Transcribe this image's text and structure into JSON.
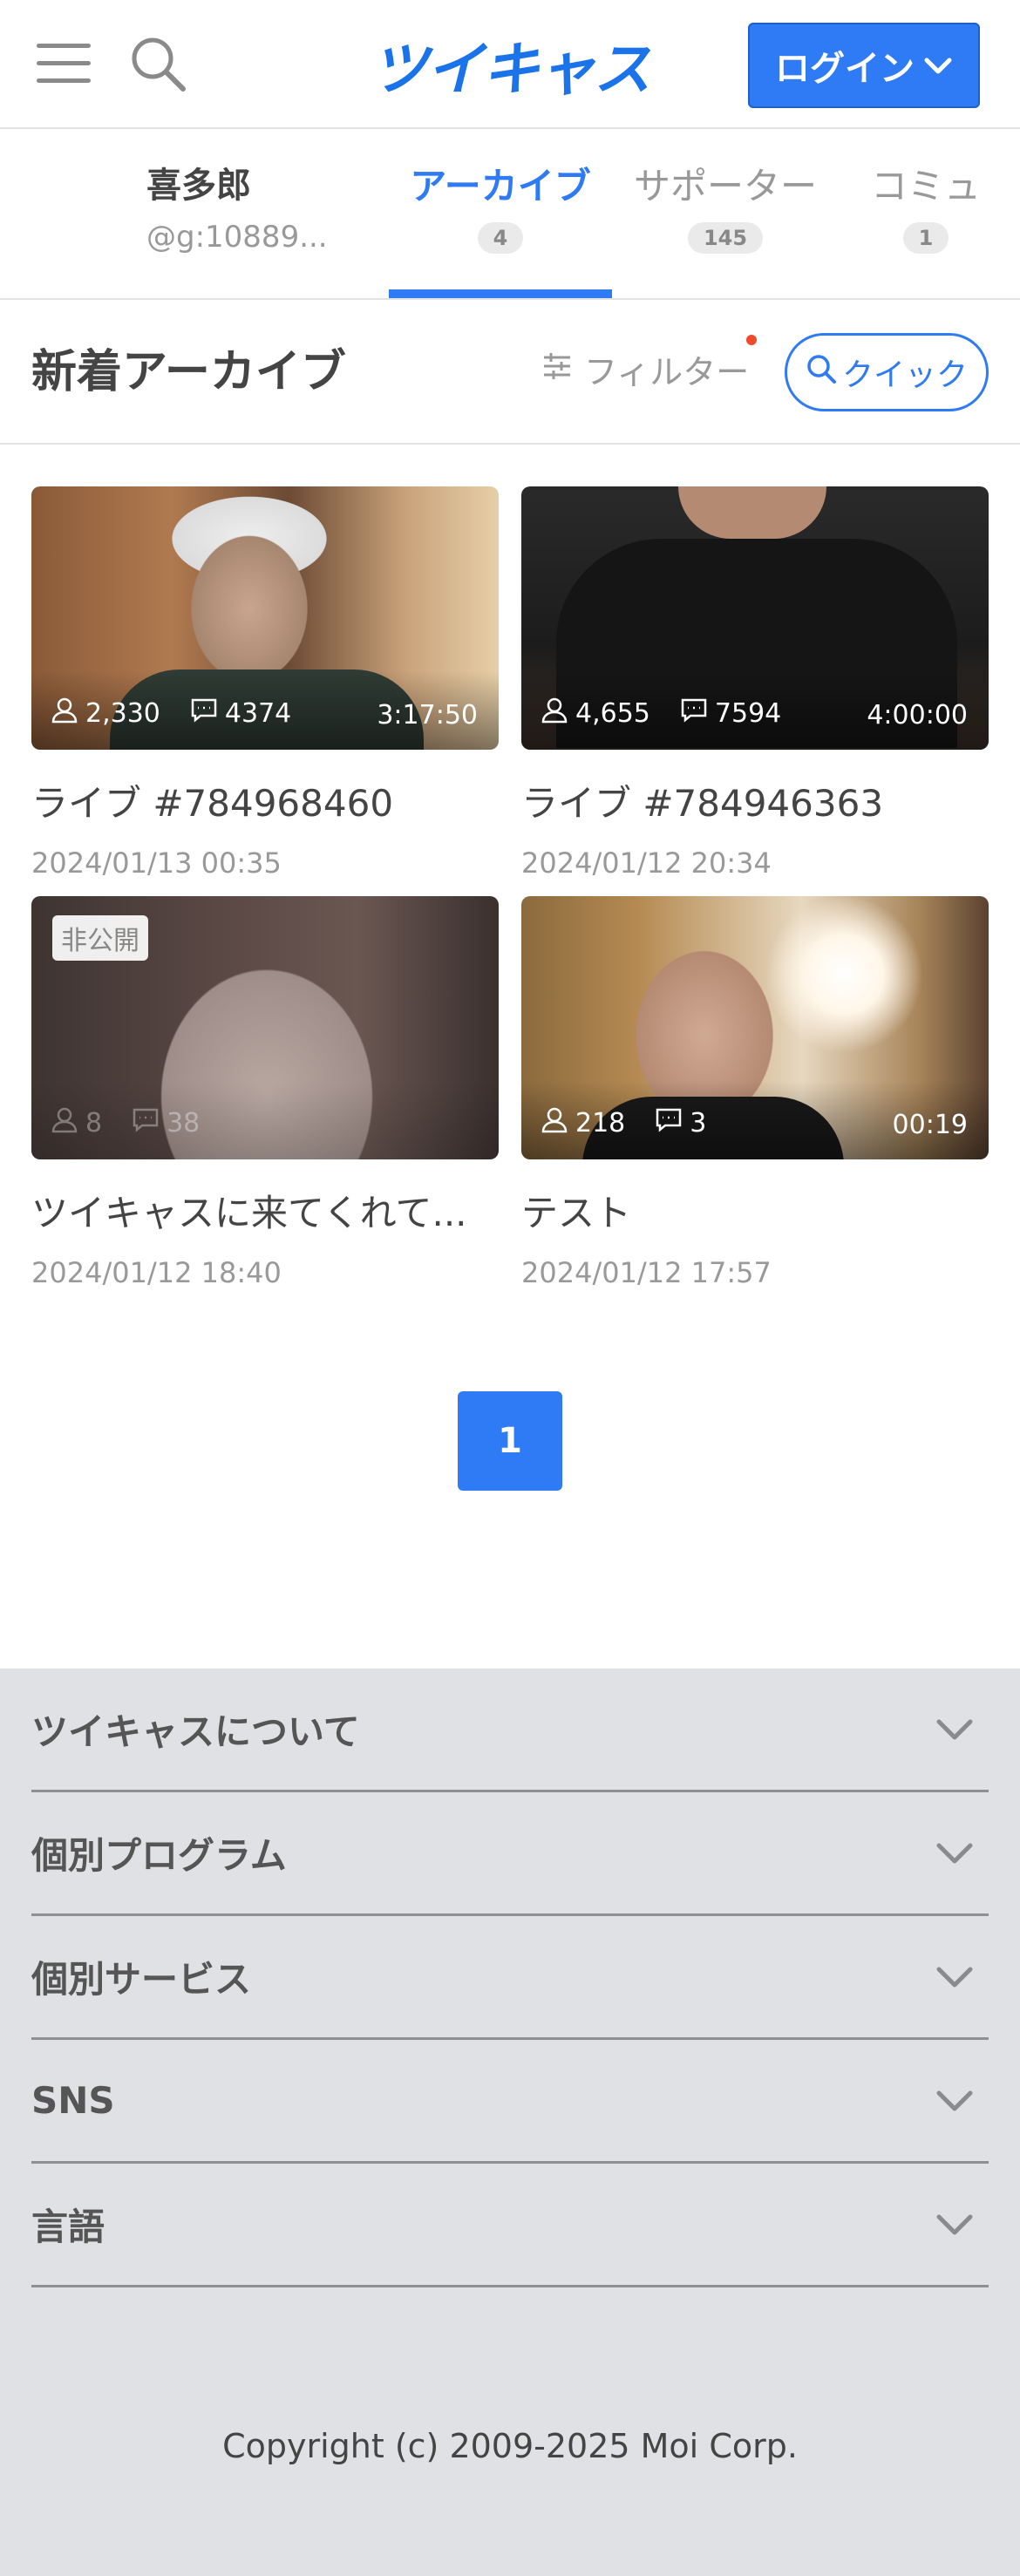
{
  "header": {
    "logo": "ツイキャス",
    "login_label": "ログイン",
    "icons": [
      "hamburger-icon",
      "search-icon",
      "chevron-down-icon"
    ]
  },
  "profile": {
    "name": "喜多郎",
    "id": "@g:10889..."
  },
  "tabs": [
    {
      "label": "アーカイブ",
      "count": "4",
      "active": true
    },
    {
      "label": "サポーター",
      "count": "145",
      "active": false
    },
    {
      "label": "コミュ",
      "count": "1",
      "active": false
    }
  ],
  "section": {
    "title": "新着アーカイブ",
    "filter_label": "フィルター",
    "quick_label": "クイック"
  },
  "archives": [
    {
      "title": "ライブ #784968460",
      "date": "2024/01/13 00:35",
      "viewers": "2,330",
      "comments": "4374",
      "duration": "3:17:50",
      "private": false
    },
    {
      "title": "ライブ #784946363",
      "date": "2024/01/12 20:34",
      "viewers": "4,655",
      "comments": "7594",
      "duration": "4:00:00",
      "private": false
    },
    {
      "title": "ツイキャスに来てくれて...",
      "date": "2024/01/12 18:40",
      "viewers": "8",
      "comments": "38",
      "duration": "",
      "private": true,
      "private_label": "非公開"
    },
    {
      "title": "テスト",
      "date": "2024/01/12 17:57",
      "viewers": "218",
      "comments": "3",
      "duration": "00:19",
      "private": false
    }
  ],
  "pagination": {
    "current": "1"
  },
  "footer": {
    "sections": [
      "ツイキャスについて",
      "個別プログラム",
      "個別サービス",
      "SNS",
      "言語"
    ],
    "copyright": "Copyright (c) 2009-2025 Moi Corp."
  },
  "colors": {
    "accent": "#2f7bf5",
    "footer_bg": "#dfe1e5",
    "notification_dot": "#f04a2d"
  }
}
